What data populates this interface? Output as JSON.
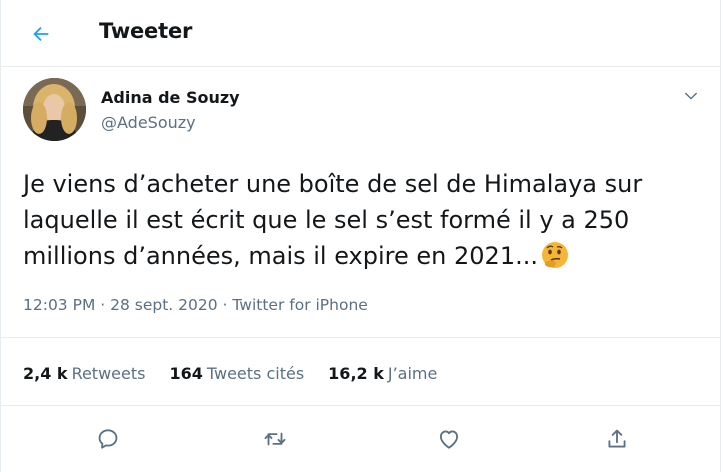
{
  "header": {
    "title": "Tweeter",
    "back_icon": "arrow-left-icon"
  },
  "author": {
    "name": "Adina de Souzy",
    "handle": "@AdeSouzy",
    "menu_icon": "chevron-down-icon"
  },
  "tweet": {
    "text": "Je viens d’acheter une boîte de sel de Himalaya sur laquelle il est écrit que le sel s’est formé il y a 250 millions d’années, mais il expire en 2021...",
    "emoji": "thinking-face-emoji"
  },
  "meta": {
    "time": "12:03 PM",
    "separator1": " · ",
    "date": "28 sept. 2020",
    "separator2": " · ",
    "source": "Twitter for iPhone"
  },
  "stats": [
    {
      "count": "2,4 k",
      "label": "Retweets"
    },
    {
      "count": "164",
      "label": "Tweets cités"
    },
    {
      "count": "16,2 k",
      "label": "J’aime"
    }
  ],
  "actions": [
    "reply-icon",
    "retweet-icon",
    "like-icon",
    "share-icon"
  ],
  "colors": {
    "accent": "#1da1f2",
    "secondary_text": "#5b7083",
    "border": "#e6ecf0"
  }
}
